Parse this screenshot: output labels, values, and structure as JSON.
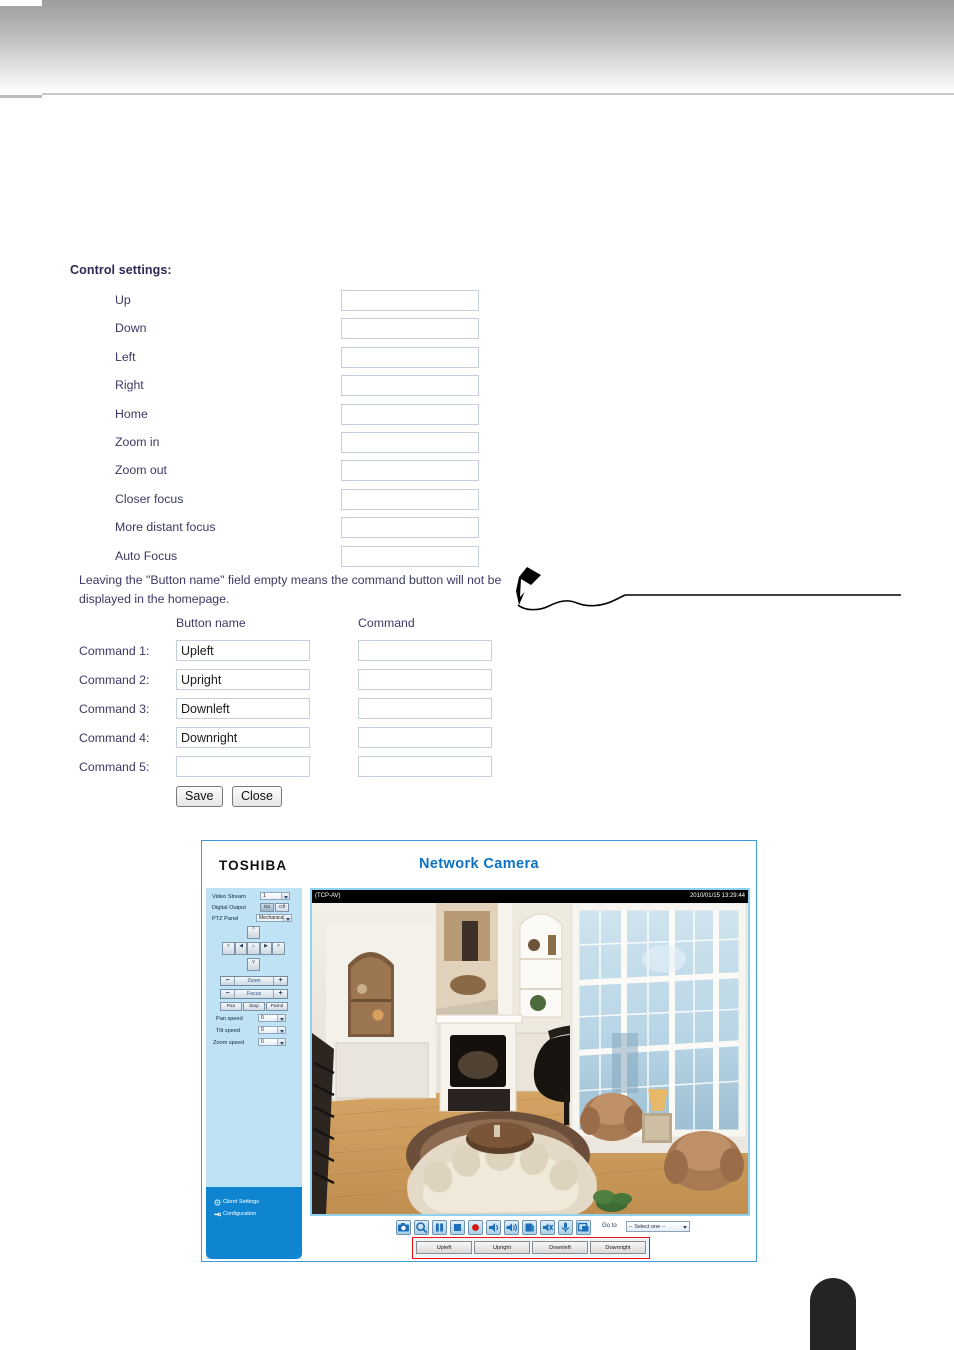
{
  "page": {
    "section_title": "Control settings:",
    "note_text": "Leaving the \"Button name\" field empty means the command button will not be displayed in the homepage."
  },
  "control_settings": {
    "rows": [
      {
        "label": "Up",
        "value": ""
      },
      {
        "label": "Down",
        "value": ""
      },
      {
        "label": "Left",
        "value": ""
      },
      {
        "label": "Right",
        "value": ""
      },
      {
        "label": "Home",
        "value": ""
      },
      {
        "label": "Zoom in",
        "value": ""
      },
      {
        "label": "Zoom out",
        "value": ""
      },
      {
        "label": "Closer focus",
        "value": ""
      },
      {
        "label": "More distant focus",
        "value": ""
      },
      {
        "label": "Auto Focus",
        "value": ""
      }
    ]
  },
  "command_table": {
    "header_button_name": "Button name",
    "header_command": "Command",
    "rows": [
      {
        "label": "Command 1:",
        "button_name": "Upleft",
        "command": ""
      },
      {
        "label": "Command 2:",
        "button_name": "Upright",
        "command": ""
      },
      {
        "label": "Command 3:",
        "button_name": "Downleft",
        "command": ""
      },
      {
        "label": "Command 4:",
        "button_name": "Downright",
        "command": ""
      },
      {
        "label": "Command 5:",
        "button_name": "",
        "command": ""
      }
    ],
    "save_label": "Save",
    "close_label": "Close"
  },
  "camera_app": {
    "brand": "TOSHIBA",
    "title": "Network Camera",
    "sidebar": {
      "video_stream_label": "Video Stream",
      "video_stream_value": "1",
      "digital_output_label": "Digital Output",
      "digital_output_on": "On",
      "digital_output_off": "Off",
      "ptz_panel_label": "PTZ Panel",
      "ptz_panel_value": "Mechanical",
      "zoom_label": "Zoom",
      "focus_label": "Focus",
      "minus": "−",
      "plus": "+",
      "pan_button": "Pan",
      "stop_button": "Stop",
      "patrol_button": "Patrol",
      "pan_speed_label": "Pan speed",
      "pan_speed_value": "0",
      "tilt_speed_label": "Tilt speed",
      "tilt_speed_value": "0",
      "zoom_speed_label": "Zoom speed",
      "zoom_speed_value": "0",
      "client_settings_link": "Client Settings",
      "configuration_link": "Configuration"
    },
    "video": {
      "osd_left": "(TCP-AV)",
      "osd_right": "2010/01/15 13:29:44"
    },
    "toolbar": {
      "goto_label": "Go to",
      "goto_value": "-- Select one --",
      "icons": [
        "snapshot-icon",
        "digital-zoom-icon",
        "pause-icon",
        "stop-icon",
        "record-icon",
        "volume-icon",
        "speaker-icon",
        "talk-icon",
        "mute-icon",
        "microphone-icon",
        "fullscreen-icon"
      ]
    },
    "command_buttons": [
      "Upleft",
      "Upright",
      "Downleft",
      "Downright"
    ],
    "highlight_color": "#ee1111"
  },
  "colors": {
    "heading": "#2b2b56",
    "label": "#3a3a63",
    "brand_blue": "#0b72c4",
    "panel_blue": "#bfe3f5",
    "panel_deep_blue": "#0f85d2",
    "input_border": "#c6cede"
  }
}
